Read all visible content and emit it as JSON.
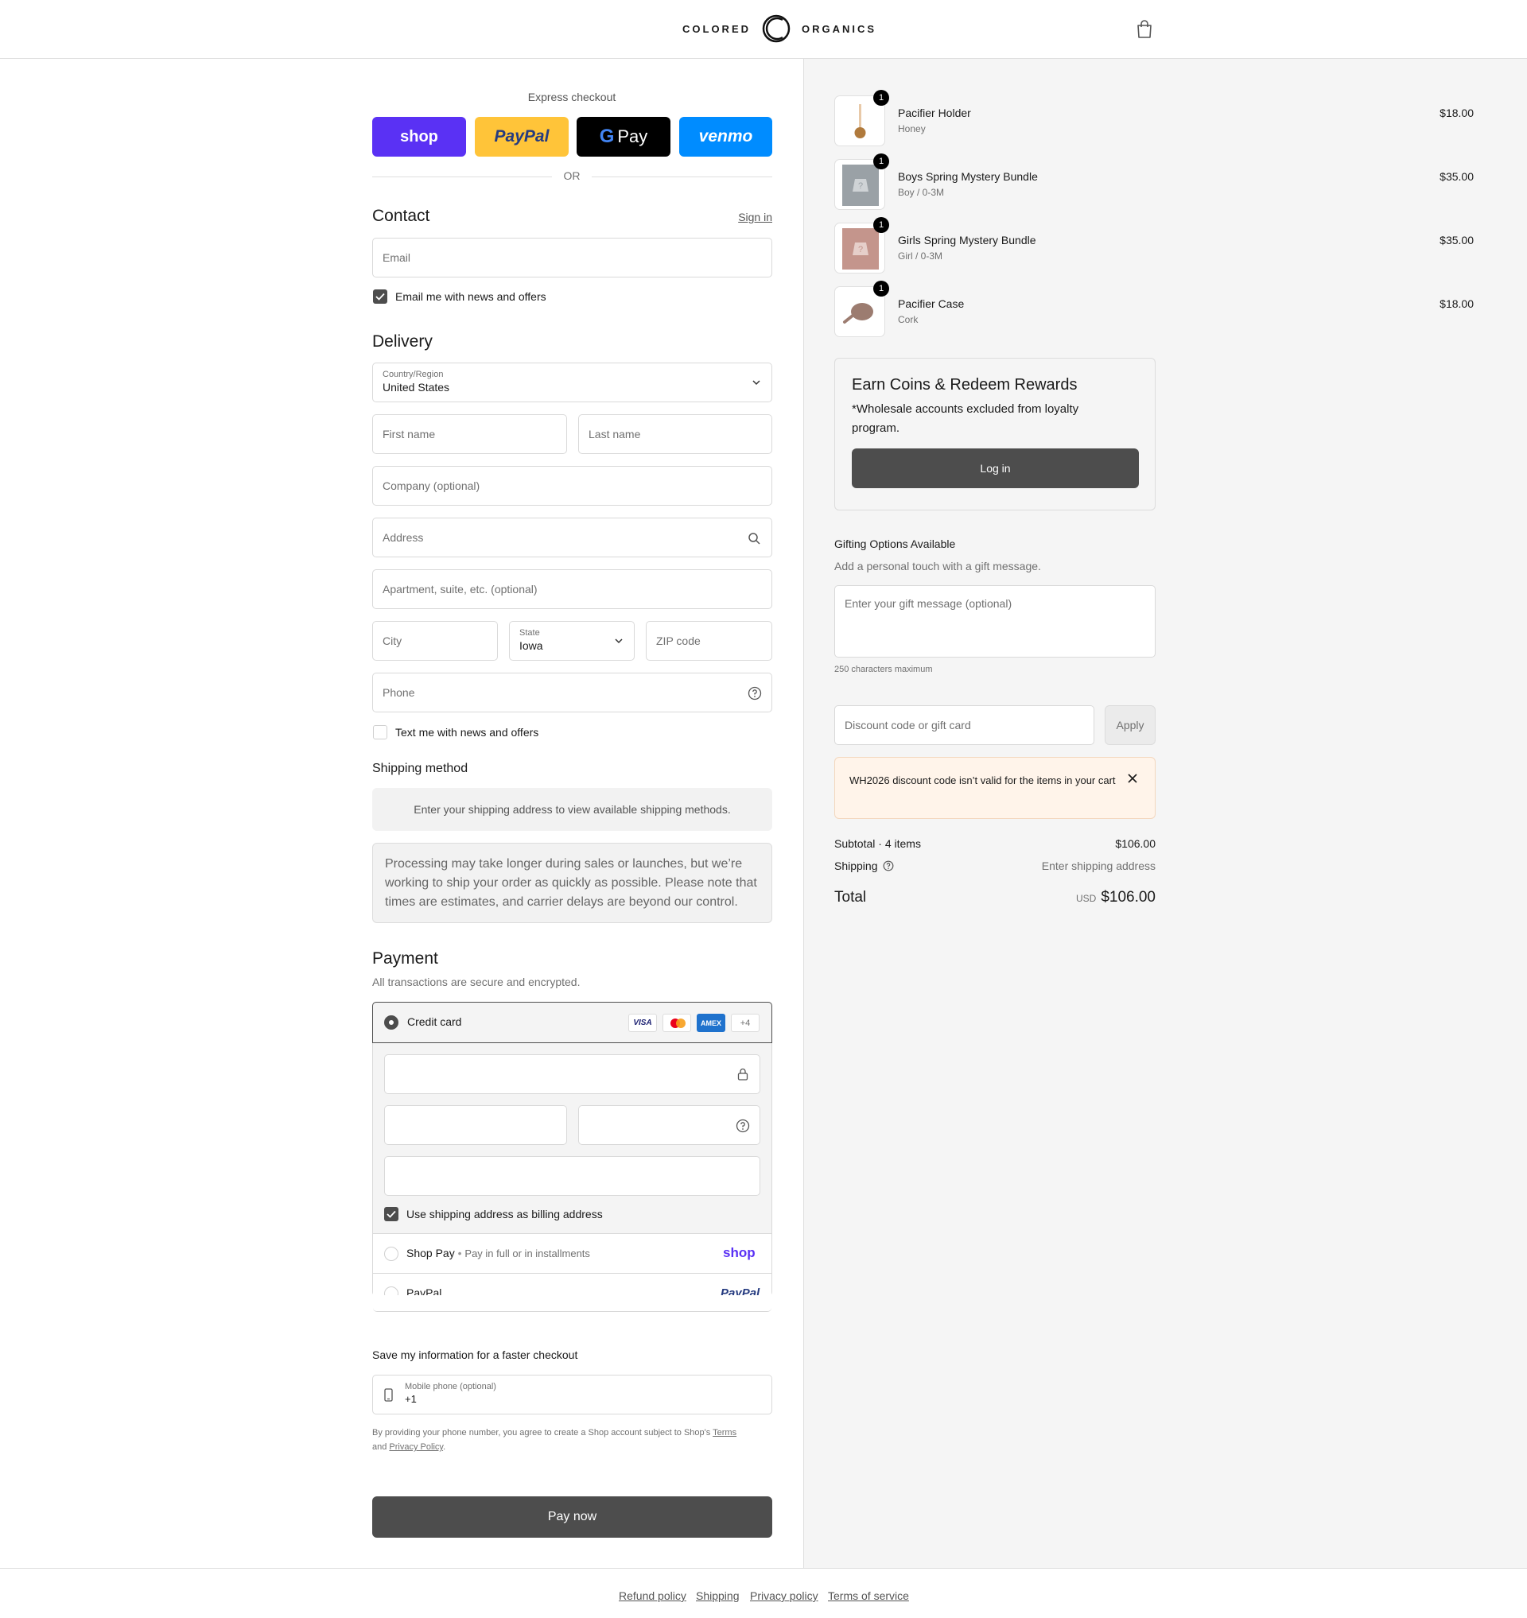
{
  "header": {
    "brand_left": "COLORED",
    "brand_right": "ORGANICS"
  },
  "express": {
    "title": "Express checkout",
    "shop": "shop",
    "paypal": "PayPal",
    "gpay": "Pay",
    "venmo": "venmo",
    "or": "OR"
  },
  "contact": {
    "title": "Contact",
    "sign_in": "Sign in",
    "email_placeholder": "Email",
    "email_optin": "Email me with news and offers"
  },
  "delivery": {
    "title": "Delivery",
    "country_label": "Country/Region",
    "country_value": "United States",
    "first_name": "First name",
    "last_name": "Last name",
    "company": "Company (optional)",
    "address": "Address",
    "apartment": "Apartment, suite, etc. (optional)",
    "city": "City",
    "state_label": "State",
    "state_value": "Iowa",
    "zip": "ZIP code",
    "phone": "Phone",
    "text_optin": "Text me with news and offers"
  },
  "shipping_method": {
    "title": "Shipping method",
    "notice": "Enter your shipping address to view available shipping methods.",
    "processing": "Processing may take longer during sales or launches, but we’re working to ship your order as quickly as possible. Please note that times are estimates, and carrier delays are beyond our control."
  },
  "payment": {
    "title": "Payment",
    "subtitle": "All transactions are secure and encrypted.",
    "credit_card": "Credit card",
    "cards": [
      "VISA",
      "",
      "AMEX",
      "+4"
    ],
    "billing_same": "Use shipping address as billing address",
    "shop_pay": "Shop Pay",
    "shop_pay_note": "Pay in full or in installments",
    "shop_pay_logo": "shop",
    "paypal": "PayPal",
    "paypal_logo": "PayPal"
  },
  "save_info": {
    "title": "Save my information for a faster checkout",
    "mobile_label": "Mobile phone (optional)",
    "mobile_value": "+1",
    "disclaimer_a": "By providing your phone number, you agree to create a Shop account subject to Shop's ",
    "terms": "Terms",
    "disclaimer_b": "and ",
    "privacy": "Privacy Policy",
    "disclaimer_c": "."
  },
  "pay_now": "Pay now",
  "cart_items": [
    {
      "name": "Pacifier Holder",
      "variant": "Honey",
      "price": "$18.00",
      "qty": "1"
    },
    {
      "name": "Boys Spring Mystery Bundle",
      "variant": "Boy / 0-3M",
      "price": "$35.00",
      "qty": "1"
    },
    {
      "name": "Girls Spring Mystery Bundle",
      "variant": "Girl / 0-3M",
      "price": "$35.00",
      "qty": "1"
    },
    {
      "name": "Pacifier Case",
      "variant": "Cork",
      "price": "$18.00",
      "qty": "1"
    }
  ],
  "rewards": {
    "title": "Earn Coins & Redeem Rewards",
    "note": "*Wholesale accounts excluded from loyalty program.",
    "login": "Log in"
  },
  "gifting": {
    "title": "Gifting Options Available",
    "subtitle": "Add a personal touch with a gift message.",
    "placeholder": "Enter your gift message (optional)",
    "limit": "250 characters maximum"
  },
  "discount": {
    "placeholder": "Discount code or gift card",
    "apply": "Apply",
    "error": "WH2026 discount code isn’t valid for the items in your cart"
  },
  "totals": {
    "subtotal_label": "Subtotal · 4 items",
    "subtotal": "$106.00",
    "shipping_label": "Shipping",
    "shipping": "Enter shipping address",
    "total_label": "Total",
    "currency": "USD",
    "total": "$106.00"
  },
  "footer": {
    "links": [
      "Refund policy",
      "Shipping",
      "Privacy policy",
      "Terms of service"
    ]
  },
  "colors": {
    "shop": "#5a31f4",
    "paypal": "#ffc439",
    "venmo": "#008cff",
    "dark_button": "#4d4d4d",
    "error_bg": "#fff4ea"
  }
}
